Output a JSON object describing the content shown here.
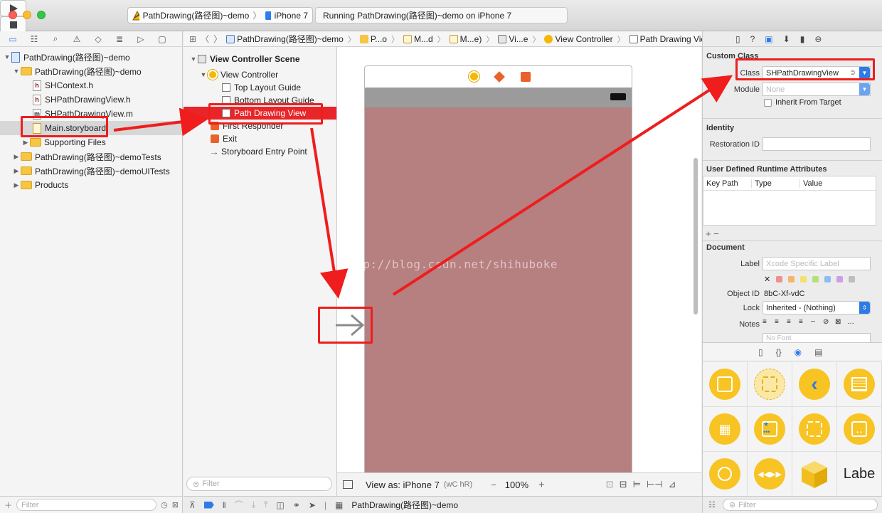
{
  "toolbar": {
    "scheme_project": "PathDrawing(路径图)~demo",
    "scheme_device": "iPhone 7",
    "status_text": "Running PathDrawing(路径图)~demo on iPhone 7"
  },
  "navigator": {
    "items": [
      {
        "label": "PathDrawing(路径图)~demo"
      },
      {
        "label": "PathDrawing(路径图)~demo"
      },
      {
        "label": "SHContext.h"
      },
      {
        "label": "SHPathDrawingView.h"
      },
      {
        "label": "SHPathDrawingView.m"
      },
      {
        "label": "Main.storyboard"
      },
      {
        "label": "Supporting Files"
      },
      {
        "label": "PathDrawing(路径图)~demoTests"
      },
      {
        "label": "PathDrawing(路径图)~demoUITests"
      },
      {
        "label": "Products"
      }
    ],
    "filter_placeholder": "Filter"
  },
  "jumpbar": {
    "items": [
      "PathDrawing(路径图)~demo",
      "P...o",
      "M...d",
      "M...e)",
      "Vi...e",
      "View Controller",
      "Path Drawing View"
    ]
  },
  "outline": {
    "scene": "View Controller Scene",
    "controller": "View Controller",
    "top_guide": "Top Layout Guide",
    "bottom_guide": "Bottom Layout Guide",
    "path_view": "Path Drawing View",
    "first_responder": "First Responder",
    "exit": "Exit",
    "entry_point": "Storyboard Entry Point",
    "filter_placeholder": "Filter"
  },
  "canvas": {
    "watermark": "http://blog.csdn.net/shihuboke",
    "view_as": "View as: iPhone 7",
    "size_class": "(wC hR)",
    "zoom": "100%"
  },
  "debugbar": {
    "target": "PathDrawing(路径图)~demo"
  },
  "inspector": {
    "custom_class_title": "Custom Class",
    "class_label": "Class",
    "class_value": "SHPathDrawingView",
    "module_label": "Module",
    "module_placeholder": "None",
    "inherit_label": "Inherit From Target",
    "identity_title": "Identity",
    "restoration_label": "Restoration ID",
    "udra_title": "User Defined Runtime Attributes",
    "col_key_path": "Key Path",
    "col_type": "Type",
    "col_value": "Value",
    "add_remove": "+  −",
    "document_title": "Document",
    "label_label": "Label",
    "label_placeholder": "Xcode Specific Label",
    "object_id_label": "Object ID",
    "object_id_value": "8bC-Xf-vdC",
    "lock_label": "Lock",
    "lock_value": "Inherited - (Nothing)",
    "notes_label": "Notes",
    "font_placeholder": "No Font"
  },
  "library": {
    "last_label": "Labe",
    "filter_placeholder": "Filter"
  },
  "colors": {
    "highlight_red": "#ef1d1d",
    "view_background": "#b67f80",
    "accent_blue": "#2f7be6",
    "object_yellow": "#f7c424"
  }
}
